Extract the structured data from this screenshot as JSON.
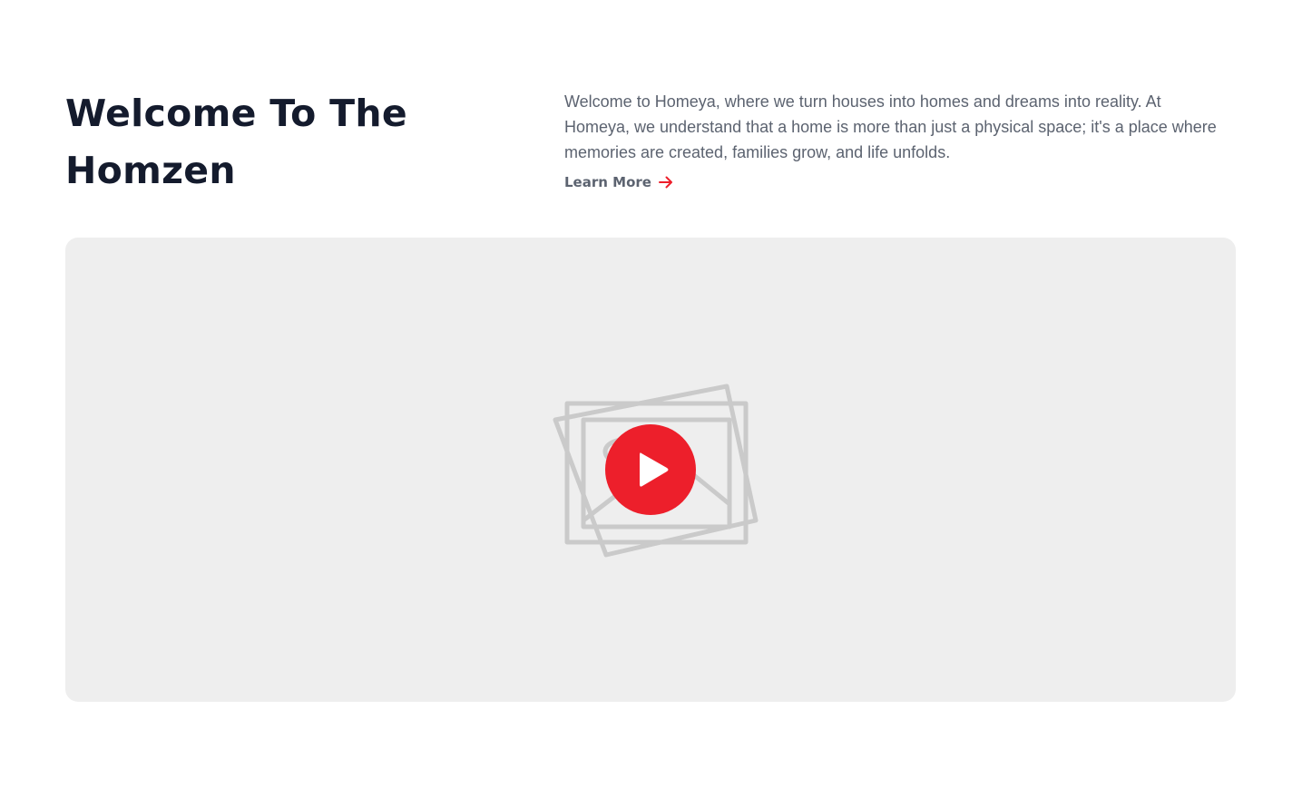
{
  "intro": {
    "title_line1": "Welcome To The",
    "title_line2": "Homzen",
    "description": "Welcome to Homeya, where we turn houses into homes and dreams into reality. At Homeya, we understand that a home is more than just a physical space; it's a place where memories are created, families grow, and life unfolds.",
    "link_label": "Learn More",
    "link_icon": "arrow-right-icon"
  },
  "media": {
    "placeholder_icon": "image-placeholder-icon",
    "play_icon": "play-icon"
  },
  "colors": {
    "heading": "#141b2d",
    "body_text": "#5c6370",
    "accent": "#ed1f2b",
    "media_background": "#eeeeee",
    "placeholder_stroke": "#cacaca"
  }
}
